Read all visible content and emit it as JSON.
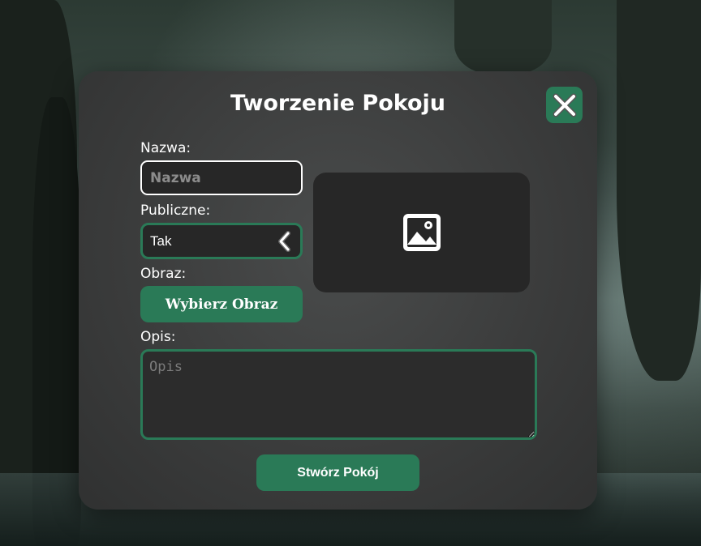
{
  "modal": {
    "title": "Tworzenie Pokoju",
    "close_icon": "close-icon"
  },
  "form": {
    "name_label": "Nazwa:",
    "name_placeholder": "Nazwa",
    "name_value": "",
    "public_label": "Publiczne:",
    "public_value": "Tak",
    "public_chevron_icon": "chevron-left-icon",
    "image_label": "Obraz:",
    "choose_image_label": "Wybierz Obraz",
    "image_placeholder_icon": "image-icon",
    "description_label": "Opis:",
    "description_placeholder": "Opis",
    "description_value": "",
    "create_label": "Stwórz Pokój"
  },
  "colors": {
    "accent": "#2a7a57",
    "modal_bg": "#3a3b3b",
    "input_bg": "#272727",
    "text": "#ffffff"
  }
}
